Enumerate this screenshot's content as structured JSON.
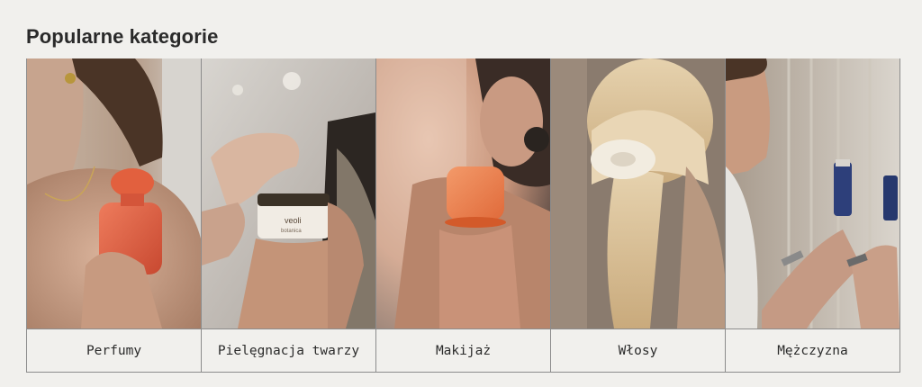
{
  "section": {
    "title": "Popularne kategorie"
  },
  "categories": [
    {
      "label": "Perfumy",
      "image": "perfume-photo"
    },
    {
      "label": "Pielęgnacja twarzy",
      "image": "face-care-photo"
    },
    {
      "label": "Makijaż",
      "image": "makeup-photo"
    },
    {
      "label": "Włosy",
      "image": "hair-photo"
    },
    {
      "label": "Mężczyzna",
      "image": "men-photo"
    }
  ],
  "product_text": {
    "veoli_brand": "veoli",
    "veoli_sub": "botanica"
  }
}
